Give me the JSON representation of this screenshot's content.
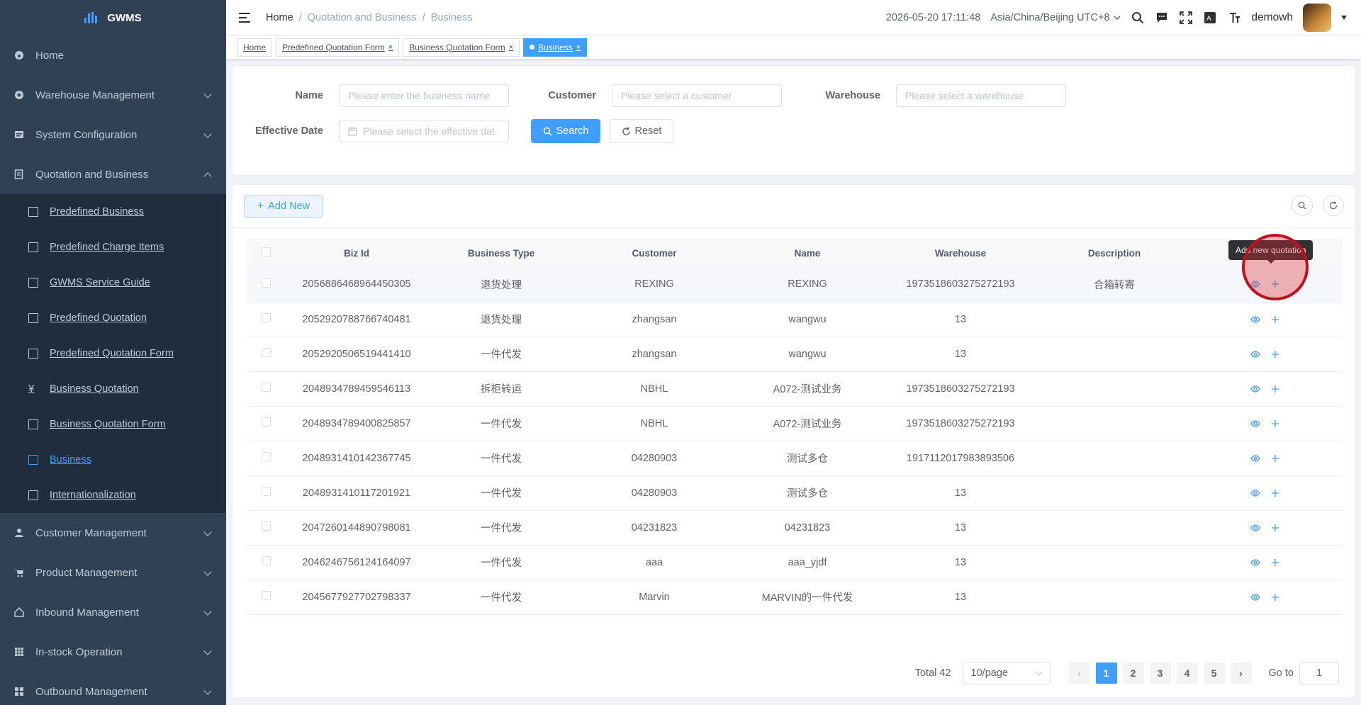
{
  "app": {
    "title": "GWMS"
  },
  "sidebar": {
    "items": [
      {
        "label": "Home",
        "icon": "dashboard-icon"
      },
      {
        "label": "Warehouse Management",
        "icon": "warehouse-icon"
      },
      {
        "label": "System Configuration",
        "icon": "config-icon"
      },
      {
        "label": "Quotation and Business",
        "icon": "quotation-icon"
      }
    ],
    "sub_items": [
      {
        "label": "Predefined Business",
        "icon": "folder-icon"
      },
      {
        "label": "Predefined Charge Items",
        "icon": "grid-icon"
      },
      {
        "label": "GWMS Service Guide",
        "icon": "guide-icon"
      },
      {
        "label": "Predefined Quotation",
        "icon": "document-icon"
      },
      {
        "label": "Predefined Quotation Form",
        "icon": "edit-form-icon"
      },
      {
        "label": "Business Quotation",
        "icon": "yen-icon"
      },
      {
        "label": "Business Quotation Form",
        "icon": "edit-form-icon"
      },
      {
        "label": "Business",
        "icon": "business-icon"
      },
      {
        "label": "Internationalization",
        "icon": "translate-icon"
      }
    ],
    "bottom_items": [
      {
        "label": "Customer Management",
        "icon": "user-icon"
      },
      {
        "label": "Product Management",
        "icon": "cart-icon"
      },
      {
        "label": "Inbound Management",
        "icon": "home-icon"
      },
      {
        "label": "In-stock Operation",
        "icon": "table-icon"
      },
      {
        "label": "Outbound Management",
        "icon": "apps-icon"
      }
    ]
  },
  "header": {
    "breadcrumb": [
      "Home",
      "Quotation and Business",
      "Business"
    ],
    "datetime": "2026-05-20 17:11:48",
    "timezone": "Asia/China/Beijing UTC+8",
    "username": "demowh"
  },
  "tags": [
    "Home",
    "Predefined Quotation Form",
    "Business Quotation Form",
    "Business"
  ],
  "search": {
    "name_label": "Name",
    "name_placeholder": "Please enter the business name",
    "customer_label": "Customer",
    "customer_placeholder": "Please select a customer",
    "warehouse_label": "Warehouse",
    "warehouse_placeholder": "Please select a warehouse",
    "date_label": "Effective Date",
    "date_placeholder": "Please select the effective dat",
    "search_btn": "Search",
    "reset_btn": "Reset"
  },
  "toolbar": {
    "add_new": "Add New"
  },
  "table": {
    "columns": [
      "Biz Id",
      "Business Type",
      "Customer",
      "Name",
      "Warehouse",
      "Description"
    ],
    "rows": [
      [
        "2056886468964450305",
        "退货处理",
        "REXING",
        "REXING",
        "1973518603275272193",
        "合箱转寄"
      ],
      [
        "2052920788766740481",
        "退货处理",
        "zhangsan",
        "wangwu",
        "13",
        ""
      ],
      [
        "2052920506519441410",
        "一件代发",
        "zhangsan",
        "wangwu",
        "13",
        ""
      ],
      [
        "2048934789459546113",
        "拆柜转运",
        "NBHL",
        "A072-测试业务",
        "1973518603275272193",
        ""
      ],
      [
        "2048934789400825857",
        "一件代发",
        "NBHL",
        "A072-测试业务",
        "1973518603275272193",
        ""
      ],
      [
        "2048931410142367745",
        "一件代发",
        "04280903",
        "测试多仓",
        "1917112017983893506",
        ""
      ],
      [
        "2048931410117201921",
        "一件代发",
        "04280903",
        "测试多仓",
        "13",
        ""
      ],
      [
        "2047260144890798081",
        "一件代发",
        "04231823",
        "04231823",
        "13",
        ""
      ],
      [
        "2046246756124164097",
        "一件代发",
        "aaa",
        "aaa_yjdf",
        "13",
        ""
      ],
      [
        "2045677927702798337",
        "一件代发",
        "Marvin",
        "MARVIN的一件代发",
        "13",
        ""
      ]
    ]
  },
  "tooltip": "Add new quotation",
  "pagination": {
    "total": "Total 42",
    "page_size": "10/page",
    "pages": [
      "1",
      "2",
      "3",
      "4",
      "5"
    ],
    "goto_label": "Go to",
    "goto_value": "1"
  },
  "colors": {
    "primary": "#409eff",
    "sidebar": "#304156",
    "highlight": "#c0101e"
  }
}
